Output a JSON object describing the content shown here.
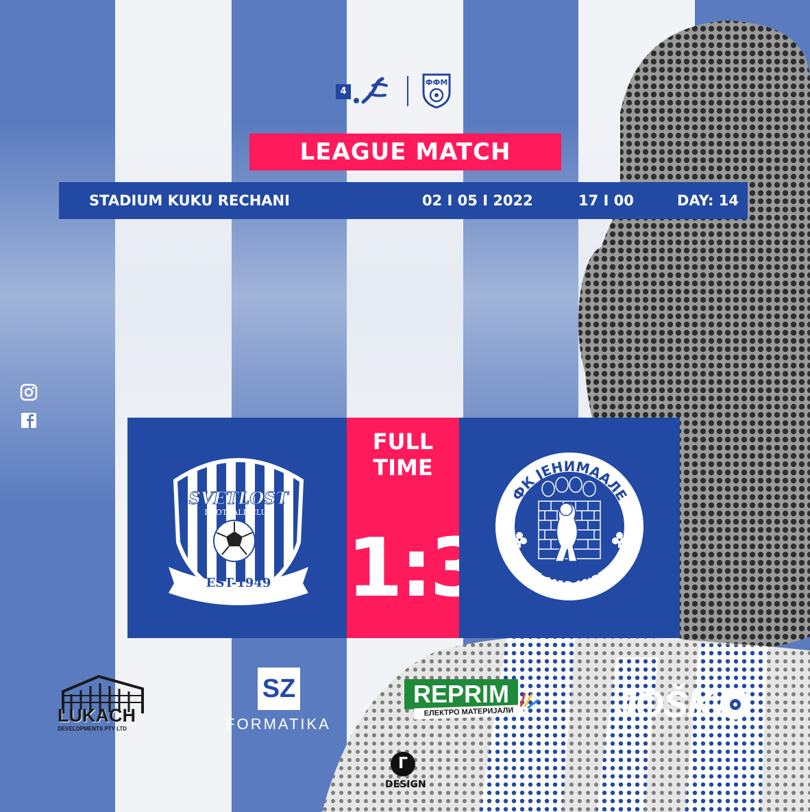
{
  "colors": {
    "blue": "#2249a4",
    "stripe_blue": "#5a7bbf",
    "accent": "#ff1a5c",
    "white": "#ffffff"
  },
  "league": {
    "round_badge": "4"
  },
  "title": "LEAGUE MATCH",
  "match_info": {
    "venue": "STADIUM KUKU RECHANI",
    "date": "02 I 05 I 2022",
    "time": "17 I 00",
    "day": "DAY: 14"
  },
  "result": {
    "status": "FULL TIME",
    "score": "1:3"
  },
  "home_team": {
    "name": "SVETLOST",
    "subtitle": "FOOTBALL CLUB",
    "est": "EST-1949"
  },
  "away_team": {
    "name": "ФК ЈЕНИМААЛЕ",
    "city": "БИТОЛА"
  },
  "federation": {
    "logo_text": "ФФМ"
  },
  "social": {
    "icons": [
      "instagram-icon",
      "facebook-icon"
    ]
  },
  "sponsors": {
    "lukach": {
      "name": "LUKACH",
      "tagline": "DEVELOPMENTS PTY LTD"
    },
    "formatika": {
      "mark": "SZ",
      "name": "FORMATIKA"
    },
    "reprim": {
      "name": "REPRIM",
      "tagline": "ЕЛЕКТРО МАТЕРИЈАЛИ"
    },
    "joska": {
      "name": "JOŠKA"
    }
  },
  "designer": {
    "mark": "Г",
    "label": "DESIGN"
  }
}
